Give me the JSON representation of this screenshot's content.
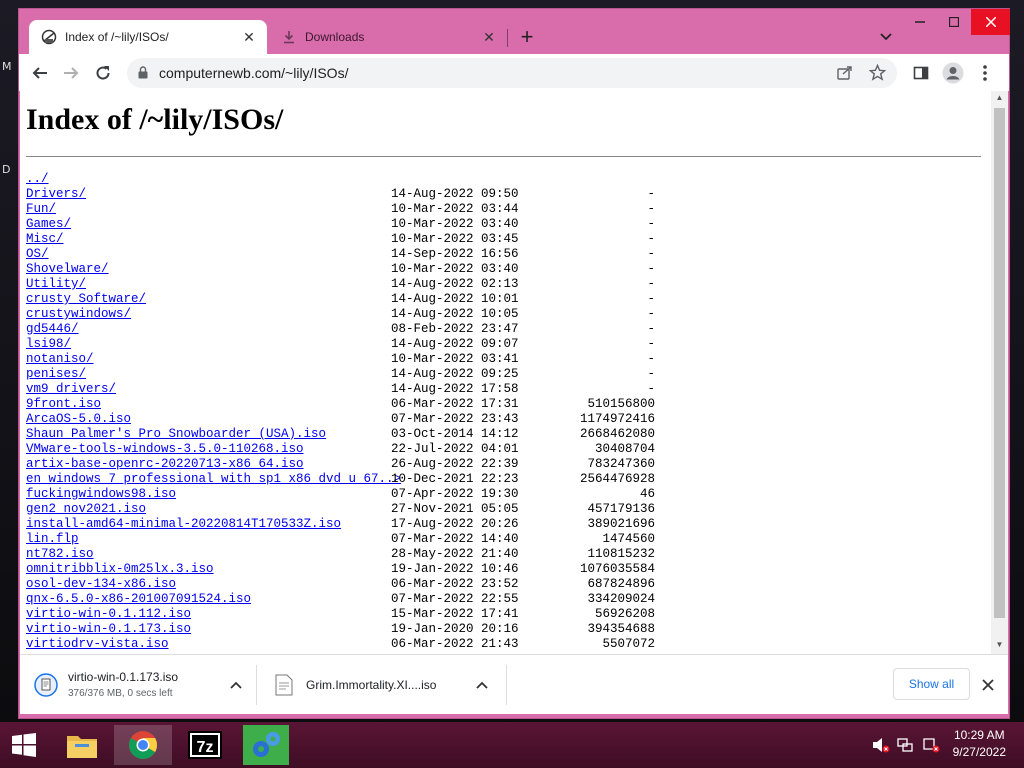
{
  "browser": {
    "tabs": [
      {
        "title": "Index of /~lily/ISOs/"
      },
      {
        "title": "Downloads"
      }
    ],
    "url": "computernewb.com/~lily/ISOs/"
  },
  "page": {
    "heading": "Index of /~lily/ISOs/",
    "entries": [
      {
        "name": "../",
        "date": "",
        "size": ""
      },
      {
        "name": "Drivers/",
        "date": "14-Aug-2022 09:50",
        "size": "-"
      },
      {
        "name": "Fun/",
        "date": "10-Mar-2022 03:44",
        "size": "-"
      },
      {
        "name": "Games/",
        "date": "10-Mar-2022 03:40",
        "size": "-"
      },
      {
        "name": "Misc/",
        "date": "10-Mar-2022 03:45",
        "size": "-"
      },
      {
        "name": "OS/",
        "date": "14-Sep-2022 16:56",
        "size": "-"
      },
      {
        "name": "Shovelware/",
        "date": "10-Mar-2022 03:40",
        "size": "-"
      },
      {
        "name": "Utility/",
        "date": "14-Aug-2022 02:13",
        "size": "-"
      },
      {
        "name": "crusty_Software/",
        "date": "14-Aug-2022 10:01",
        "size": "-"
      },
      {
        "name": "crustywindows/",
        "date": "14-Aug-2022 10:05",
        "size": "-"
      },
      {
        "name": "gd5446/",
        "date": "08-Feb-2022 23:47",
        "size": "-"
      },
      {
        "name": "lsi98/",
        "date": "14-Aug-2022 09:07",
        "size": "-"
      },
      {
        "name": "notaniso/",
        "date": "10-Mar-2022 03:41",
        "size": "-"
      },
      {
        "name": "penises/",
        "date": "14-Aug-2022 09:25",
        "size": "-"
      },
      {
        "name": "vm9_drivers/",
        "date": "14-Aug-2022 17:58",
        "size": "-"
      },
      {
        "name": "9front.iso",
        "date": "06-Mar-2022 17:31",
        "size": "510156800"
      },
      {
        "name": "ArcaOS-5.0.iso",
        "date": "07-Mar-2022 23:43",
        "size": "1174972416"
      },
      {
        "name": "Shaun_Palmer's_Pro_Snowboarder_(USA).iso",
        "date": "03-Oct-2014 14:12",
        "size": "2668462080"
      },
      {
        "name": "VMware-tools-windows-3.5.0-110268.iso",
        "date": "22-Jul-2022 04:01",
        "size": "30408704"
      },
      {
        "name": "artix-base-openrc-20220713-x86_64.iso",
        "date": "26-Aug-2022 22:39",
        "size": "783247360"
      },
      {
        "name": "en_windows_7_professional_with_sp1_x86_dvd_u_67..>",
        "date": "10-Dec-2021 22:23",
        "size": "2564476928"
      },
      {
        "name": "fuckingwindows98.iso",
        "date": "07-Apr-2022 19:30",
        "size": "46"
      },
      {
        "name": "gen2_nov2021.iso",
        "date": "27-Nov-2021 05:05",
        "size": "457179136"
      },
      {
        "name": "install-amd64-minimal-20220814T170533Z.iso",
        "date": "17-Aug-2022 20:26",
        "size": "389021696"
      },
      {
        "name": "lin.flp",
        "date": "07-Mar-2022 14:40",
        "size": "1474560"
      },
      {
        "name": "nt782.iso",
        "date": "28-May-2022 21:40",
        "size": "110815232"
      },
      {
        "name": "omnitribblix-0m25lx.3.iso",
        "date": "19-Jan-2022 10:46",
        "size": "1076035584"
      },
      {
        "name": "osol-dev-134-x86.iso",
        "date": "06-Mar-2022 23:52",
        "size": "687824896"
      },
      {
        "name": "qnx-6.5.0-x86-201007091524.iso",
        "date": "07-Mar-2022 22:55",
        "size": "334209024"
      },
      {
        "name": "virtio-win-0.1.112.iso",
        "date": "15-Mar-2022 17:41",
        "size": "56926208"
      },
      {
        "name": "virtio-win-0.1.173.iso",
        "date": "19-Jan-2020 20:16",
        "size": "394354688"
      },
      {
        "name": "virtiodrv-vista.iso",
        "date": "06-Mar-2022 21:43",
        "size": "5507072"
      }
    ]
  },
  "downloads": {
    "items": [
      {
        "name": "virtio-win-0.1.173.iso",
        "status": "376/376 MB, 0 secs left"
      },
      {
        "name": "Grim.Immortality.XI....iso",
        "status": ""
      }
    ],
    "show_all": "Show all"
  },
  "taskbar": {
    "time": "10:29 AM",
    "date": "9/27/2022",
    "apps": [
      "file-explorer",
      "chrome",
      "7-zip",
      "app"
    ]
  },
  "desktop": {
    "side_letters": [
      "M",
      "D"
    ]
  },
  "colors": {
    "window_frame": "#d96cab",
    "link": "#0000ee",
    "accent": "#1a73e8"
  }
}
